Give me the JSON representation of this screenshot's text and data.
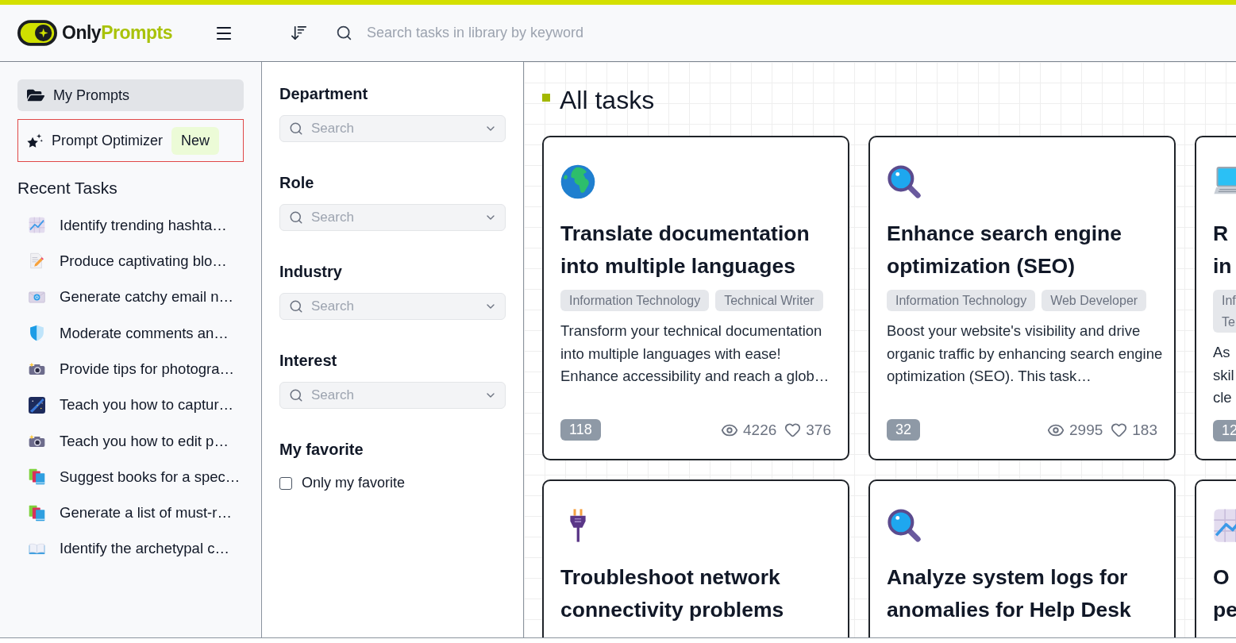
{
  "header": {
    "logo": {
      "first": "Only",
      "second": "Prompts"
    },
    "search": {
      "placeholder": "Search tasks in library by keyword"
    }
  },
  "nav": [
    {
      "kind": "folder",
      "label": "My Prompts",
      "selected": true,
      "outlined": false
    },
    {
      "kind": "sparkle",
      "label": "Prompt Optimizer",
      "badge": "New",
      "selected": false,
      "outlined": true
    }
  ],
  "recent": {
    "title": "Recent Tasks",
    "items": [
      {
        "kind": "chart",
        "label": "Identify trending hashta…"
      },
      {
        "kind": "memo",
        "label": "Produce captivating blo…"
      },
      {
        "kind": "email",
        "label": "Generate catchy email n…"
      },
      {
        "kind": "shield",
        "label": "Moderate comments an…"
      },
      {
        "kind": "camera",
        "label": "Provide tips for photogra…"
      },
      {
        "kind": "galaxy",
        "label": "Teach you how to captur…"
      },
      {
        "kind": "camera",
        "label": "Teach you how to edit p…"
      },
      {
        "kind": "books",
        "label": "Suggest books for a spec…"
      },
      {
        "kind": "books",
        "label": "Generate a list of must-r…"
      },
      {
        "kind": "book",
        "label": "Identify the archetypal c…"
      }
    ]
  },
  "filters": [
    {
      "label": "Department",
      "placeholder": "Search"
    },
    {
      "label": "Role",
      "placeholder": "Search"
    },
    {
      "label": "Industry",
      "placeholder": "Search"
    },
    {
      "label": "Interest",
      "placeholder": "Search"
    }
  ],
  "favorite": {
    "title": "My favorite",
    "label": "Only my favorite",
    "checked": false
  },
  "main": {
    "title": "All tasks",
    "cards": [
      {
        "kind": "globe",
        "title": "Translate documentation into multiple languages",
        "tags": [
          "Information Technology",
          "Technical Writer"
        ],
        "description": "Transform your technical documentation into multiple languages with ease! Enhance accessibility and reach a glob…",
        "count": "118",
        "views": "4226",
        "likes": "376"
      },
      {
        "kind": "magnifier",
        "title": "Enhance search engine optimization (SEO)",
        "tags": [
          "Information Technology",
          "Web Developer"
        ],
        "description": "Boost your website's visibility and drive organic traffic by enhancing search engine optimization (SEO). This task…",
        "count": "32",
        "views": "2995",
        "likes": "183"
      },
      {
        "kind": "laptop",
        "title": "R\nin",
        "tags": [
          "Inf\nTe"
        ],
        "description": "As\nskil\ncle",
        "count": "12"
      },
      {
        "kind": "plug",
        "title": "Troubleshoot network connectivity problems"
      },
      {
        "kind": "magnifier",
        "title": "Analyze system logs for anomalies for Help Desk"
      },
      {
        "kind": "chart",
        "title": "O\npe"
      }
    ]
  }
}
